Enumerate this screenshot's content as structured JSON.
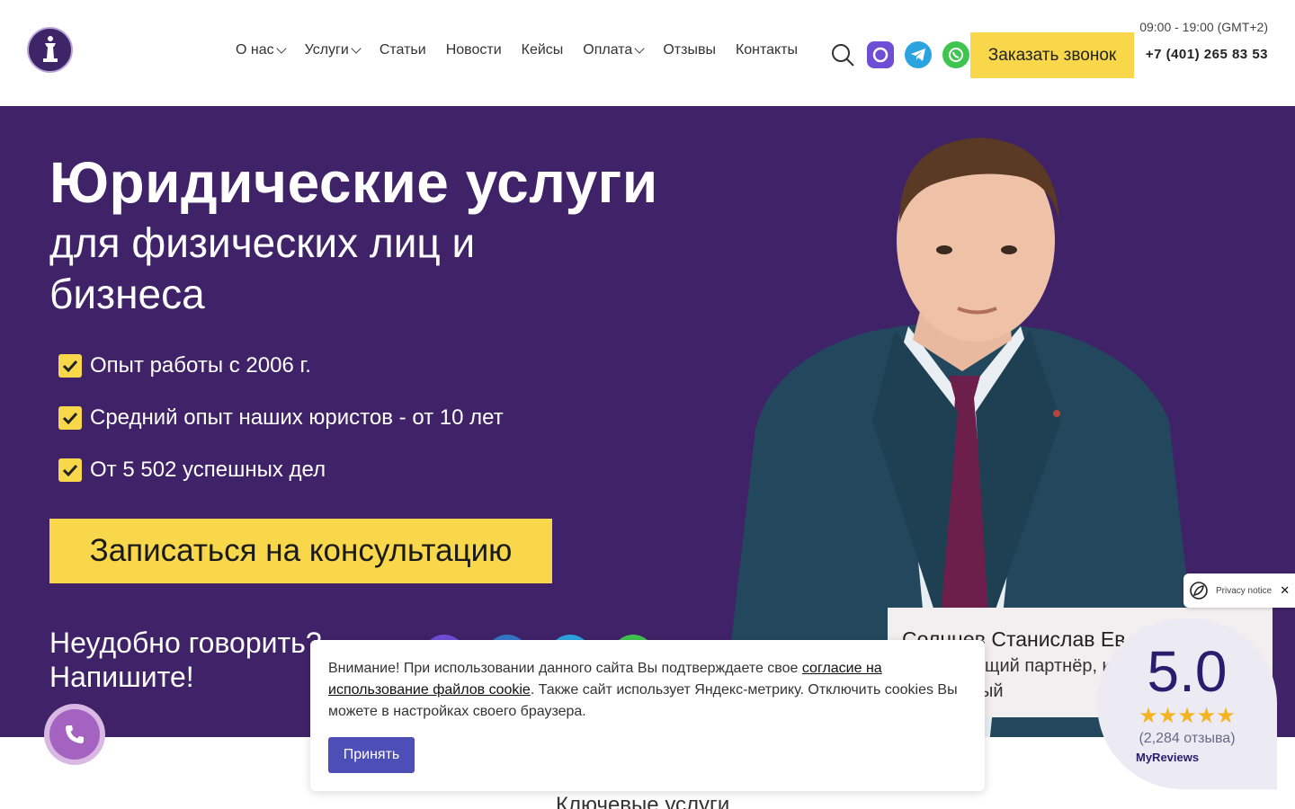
{
  "header": {
    "nav": [
      {
        "label": "О нас",
        "has_dropdown": true
      },
      {
        "label": "Услуги",
        "has_dropdown": true
      },
      {
        "label": "Статьи",
        "has_dropdown": false
      },
      {
        "label": "Новости",
        "has_dropdown": false
      },
      {
        "label": "Кейсы",
        "has_dropdown": false
      },
      {
        "label": "Оплата",
        "has_dropdown": true
      },
      {
        "label": "Отзывы",
        "has_dropdown": false
      },
      {
        "label": "Контакты",
        "has_dropdown": false
      }
    ],
    "icons": [
      "search-icon",
      "max-messenger-icon",
      "telegram-icon",
      "whatsapp-icon"
    ],
    "call_button": "Заказать звонок",
    "hours": "09:00 - 19:00 (GMT+2)",
    "phone": "+7 (401) 265 83 53"
  },
  "hero": {
    "title": "Юридические услуги",
    "subtitle": "для физических лиц и бизнеса",
    "benefits": [
      "Опыт работы с 2006 г.",
      "Средний опыт наших юристов - от 10 лет",
      "От 5 502 успешных дел"
    ],
    "cta": "Записаться на консультацию",
    "write_line1": "Неудобно говорить?",
    "write_line2": "Напишите!"
  },
  "person": {
    "name": "Солнцев Станислав Ев",
    "role_line1": "ющий партнёр, к",
    "role_line2": "ый"
  },
  "privacy": {
    "label": "Privacy notice",
    "close": "✕"
  },
  "reviews": {
    "score": "5.0",
    "stars": "★★★★★",
    "count": "(2,284 отзыва)",
    "brand": "MyReviews"
  },
  "cookie": {
    "text_before": "Внимание! При использовании данного сайта Вы подтверждаете свое ",
    "link": "согласие на использование файлов cookie",
    "text_after": ". Также сайт использует Яндекс-метрику. Отключить cookies Вы можете в настройках своего браузера.",
    "accept": "Принять"
  },
  "section": {
    "key_services": "Ключевые услуги"
  },
  "colors": {
    "hero_bg": "#3f2268",
    "accent": "#f8d84a",
    "accept_button": "#4d4fb7"
  }
}
